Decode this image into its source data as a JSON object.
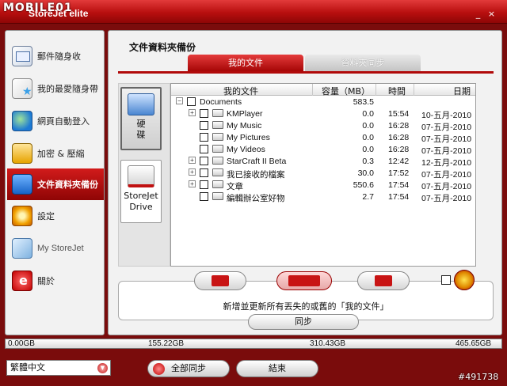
{
  "brand": {
    "logo_text": "MOBILE01",
    "app_title": "StoreJet elite"
  },
  "window": {
    "minimize": "_",
    "close": "×"
  },
  "sidebar": {
    "items": [
      {
        "label": "郵件隨身收",
        "icon": "mail-icon"
      },
      {
        "label": "我的最愛隨身帶",
        "icon": "favorites-icon"
      },
      {
        "label": "網頁自動登入",
        "icon": "web-login-icon"
      },
      {
        "label": "加密 & 壓縮",
        "icon": "encrypt-icon"
      },
      {
        "label": "文件資料夾備份",
        "icon": "folder-backup-icon",
        "active": true
      },
      {
        "label": "設定",
        "icon": "settings-icon"
      },
      {
        "label": "My StoreJet",
        "icon": "storejet-icon"
      },
      {
        "label": "關於",
        "icon": "about-icon"
      }
    ]
  },
  "main": {
    "title": "文件資料夾備份",
    "tabs": [
      {
        "label": "我的文件",
        "active": true
      },
      {
        "label": "資料夾同步",
        "active": false
      }
    ],
    "devices": [
      {
        "label": "硬\n碟"
      },
      {
        "label": "StoreJet\nDrive"
      }
    ],
    "filelist": {
      "headers": {
        "name": "我的文件",
        "size": "容量（MB）",
        "time": "時間",
        "date": "日期"
      },
      "rows": [
        {
          "name": "Documents",
          "size": "583.5",
          "time": "",
          "date": "",
          "level": 0,
          "expander": "−"
        },
        {
          "name": "KMPlayer",
          "size": "0.0",
          "time": "15:54",
          "date": "10-五月-2010",
          "level": 1,
          "expander": "+"
        },
        {
          "name": "My Music",
          "size": "0.0",
          "time": "16:28",
          "date": "07-五月-2010",
          "level": 1,
          "expander": ""
        },
        {
          "name": "My Pictures",
          "size": "0.0",
          "time": "16:28",
          "date": "07-五月-2010",
          "level": 1,
          "expander": ""
        },
        {
          "name": "My Videos",
          "size": "0.0",
          "time": "16:28",
          "date": "07-五月-2010",
          "level": 1,
          "expander": ""
        },
        {
          "name": "StarCraft II Beta",
          "size": "0.3",
          "time": "12:42",
          "date": "12-五月-2010",
          "level": 1,
          "expander": "+"
        },
        {
          "name": "我已接收的檔案",
          "size": "30.0",
          "time": "17:52",
          "date": "07-五月-2010",
          "level": 1,
          "expander": "+"
        },
        {
          "name": "文章",
          "size": "550.6",
          "time": "17:54",
          "date": "07-五月-2010",
          "level": 1,
          "expander": "+"
        },
        {
          "name": "編輯辦公室好物",
          "size": "2.7",
          "time": "17:54",
          "date": "07-五月-2010",
          "level": 1,
          "expander": ""
        }
      ]
    },
    "hint": "新增並更新所有丟失的或舊的「我的文件」",
    "sync_button": "同步"
  },
  "capacity": {
    "labels": [
      "0.00GB",
      "155.22GB",
      "310.43GB",
      "465.65GB"
    ]
  },
  "bottom": {
    "language": "繁體中文",
    "sync_all": "全部同步",
    "exit": "結束"
  },
  "watermark": "#491738",
  "colors": {
    "accent": "#c01212",
    "frame": "#7a0c0c"
  }
}
